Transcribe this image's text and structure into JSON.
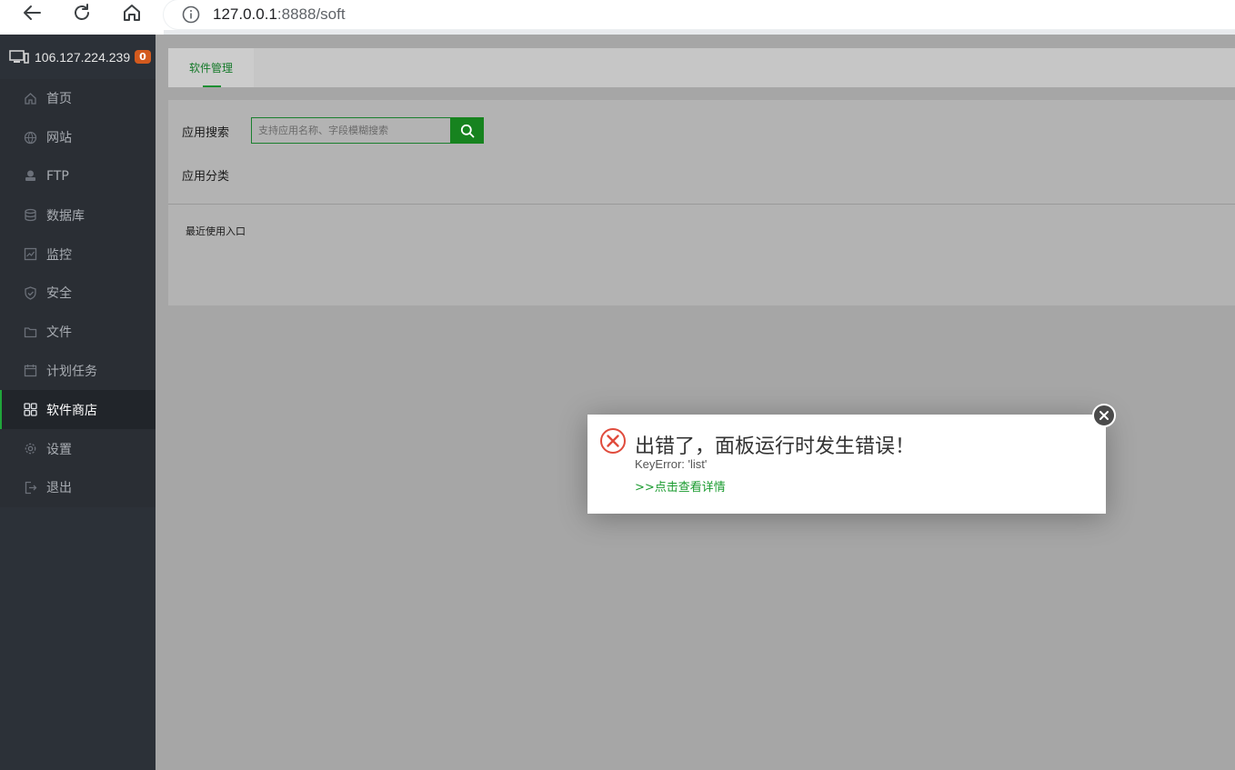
{
  "browser": {
    "url_host": "127.0.0.1",
    "url_rest": ":8888/soft"
  },
  "sidebar": {
    "host": "106.127.224.239",
    "badge": "0",
    "items": [
      {
        "label": "首页",
        "icon": "home-icon"
      },
      {
        "label": "网站",
        "icon": "globe-icon"
      },
      {
        "label": "FTP",
        "icon": "ftp-icon"
      },
      {
        "label": "数据库",
        "icon": "database-icon"
      },
      {
        "label": "监控",
        "icon": "monitor-icon"
      },
      {
        "label": "安全",
        "icon": "shield-icon"
      },
      {
        "label": "文件",
        "icon": "folder-icon"
      },
      {
        "label": "计划任务",
        "icon": "calendar-icon"
      },
      {
        "label": "软件商店",
        "icon": "grid-icon",
        "active": true
      },
      {
        "label": "设置",
        "icon": "gear-icon"
      },
      {
        "label": "退出",
        "icon": "logout-icon"
      }
    ]
  },
  "main": {
    "tab": "软件管理",
    "search_label": "应用搜索",
    "search_placeholder": "支持应用名称、字段模糊搜索",
    "category_label": "应用分类",
    "recent_label": "最近使用入口"
  },
  "dialog": {
    "title": "出错了，面板运行时发生错误！",
    "detail": "KeyError: 'list'",
    "link": ">>点击查看详情"
  },
  "colors": {
    "accent": "#20a53a",
    "sidebar_bg": "#2c3138",
    "badge": "#d35a1e",
    "error": "#e04b3c"
  }
}
